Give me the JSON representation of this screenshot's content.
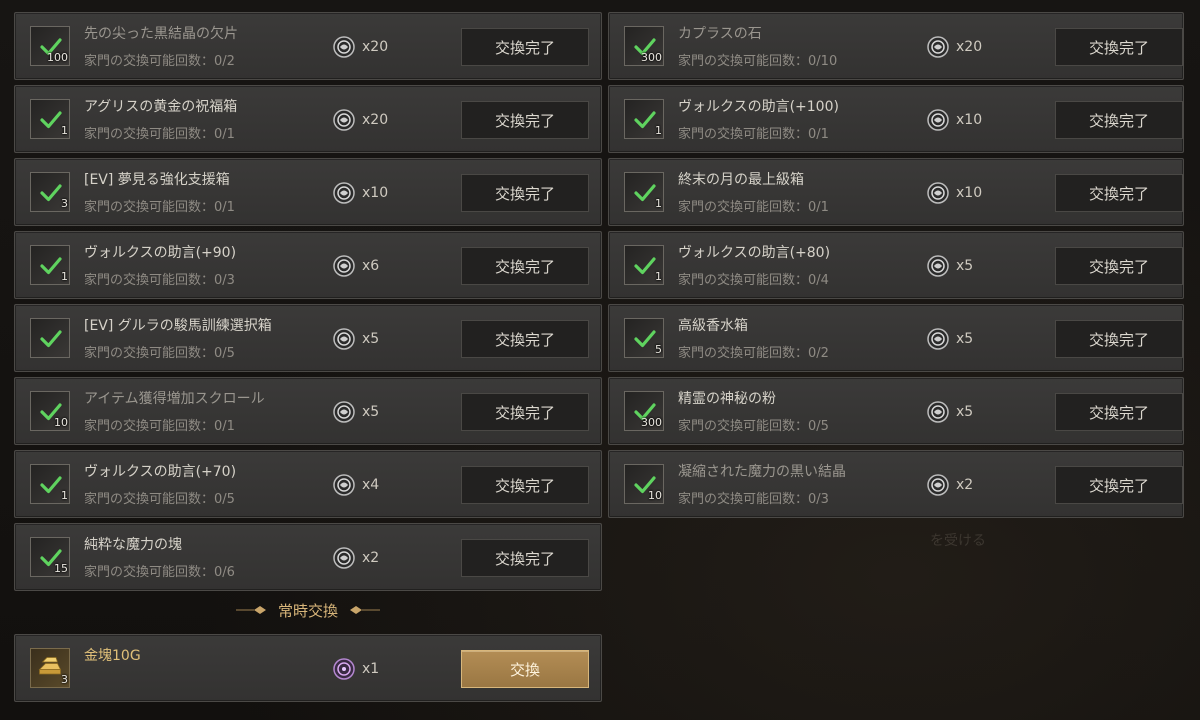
{
  "limit_prefix": "家門の交換可能回数：",
  "complete_label": "交換完了",
  "items": [
    {
      "name": "先の尖った黒結晶の欠片",
      "qty": "100",
      "limit": "0/2",
      "cost": "x20",
      "dim": true
    },
    {
      "name": "カプラスの石",
      "qty": "300",
      "limit": "0/10",
      "cost": "x20",
      "dim": true
    },
    {
      "name": "アグリスの黄金の祝福箱",
      "qty": "1",
      "limit": "0/1",
      "cost": "x20",
      "dim": false
    },
    {
      "name": "ヴォルクスの助言(+100)",
      "qty": "1",
      "limit": "0/1",
      "cost": "x10",
      "dim": false
    },
    {
      "name": "[EV] 夢見る強化支援箱",
      "qty": "3",
      "limit": "0/1",
      "cost": "x10",
      "dim": false
    },
    {
      "name": "終末の月の最上級箱",
      "qty": "1",
      "limit": "0/1",
      "cost": "x10",
      "dim": false
    },
    {
      "name": "ヴォルクスの助言(+90)",
      "qty": "1",
      "limit": "0/3",
      "cost": "x6",
      "dim": false
    },
    {
      "name": "ヴォルクスの助言(+80)",
      "qty": "1",
      "limit": "0/4",
      "cost": "x5",
      "dim": false
    },
    {
      "name": "[EV] グルラの駿馬訓練選択箱",
      "qty": "",
      "limit": "0/5",
      "cost": "x5",
      "dim": false
    },
    {
      "name": "高級香水箱",
      "qty": "5",
      "limit": "0/2",
      "cost": "x5",
      "dim": false
    },
    {
      "name": "アイテム獲得増加スクロール",
      "qty": "10",
      "limit": "0/1",
      "cost": "x5",
      "dim": true
    },
    {
      "name": "精霊の神秘の粉",
      "qty": "300",
      "limit": "0/5",
      "cost": "x5",
      "dim": false
    },
    {
      "name": "ヴォルクスの助言(+70)",
      "qty": "1",
      "limit": "0/5",
      "cost": "x4",
      "dim": false
    },
    {
      "name": "凝縮された魔力の黒い結晶",
      "qty": "10",
      "limit": "0/3",
      "cost": "x2",
      "dim": true
    },
    {
      "name": "純粋な魔力の塊",
      "qty": "15",
      "limit": "0/6",
      "cost": "x2",
      "dim": false
    }
  ],
  "section_title": "常時交換",
  "gold_item": {
    "name": "金塊10G",
    "qty": "3",
    "cost": "x1",
    "button": "交換"
  },
  "colors": {
    "check": "#5fd35f",
    "gold_accent": "#d9b67a",
    "button_gold": "#a8834c"
  }
}
